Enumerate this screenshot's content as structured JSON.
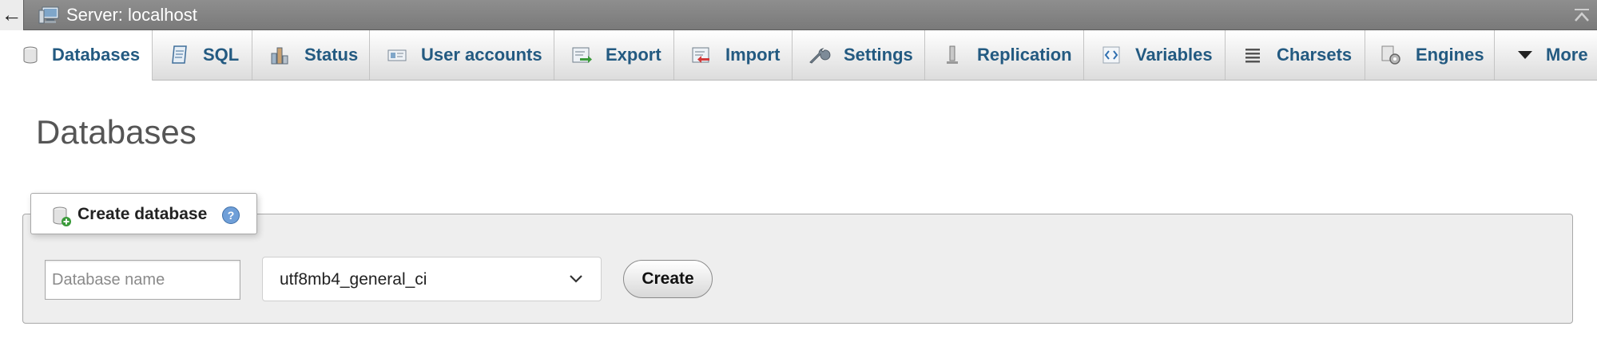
{
  "topbar": {
    "back_symbol": "←",
    "server_label": "Server: localhost",
    "server_icon": "server-icon",
    "collapse_icon": "collapse-up-icon"
  },
  "tabs": [
    {
      "label": "Databases",
      "icon": "database-icon",
      "active": true
    },
    {
      "label": "SQL",
      "icon": "sql-icon",
      "active": false
    },
    {
      "label": "Status",
      "icon": "status-chart-icon",
      "active": false
    },
    {
      "label": "User accounts",
      "icon": "user-accounts-icon",
      "active": false
    },
    {
      "label": "Export",
      "icon": "export-icon",
      "active": false
    },
    {
      "label": "Import",
      "icon": "import-icon",
      "active": false
    },
    {
      "label": "Settings",
      "icon": "wrench-icon",
      "active": false
    },
    {
      "label": "Replication",
      "icon": "replication-icon",
      "active": false
    },
    {
      "label": "Variables",
      "icon": "variables-icon",
      "active": false
    },
    {
      "label": "Charsets",
      "icon": "charsets-icon",
      "active": false
    },
    {
      "label": "Engines",
      "icon": "engines-gear-icon",
      "active": false
    },
    {
      "label": "More",
      "icon": "dropdown-triangle-icon",
      "active": false
    }
  ],
  "page": {
    "title": "Databases"
  },
  "create_database": {
    "legend": "Create database",
    "name_placeholder": "Database name",
    "name_value": "",
    "collation_value": "utf8mb4_general_ci",
    "create_label": "Create"
  },
  "colors": {
    "tab_text": "#235a81",
    "topbar_bg": "#858585",
    "fieldset_bg": "#eeeeee"
  }
}
